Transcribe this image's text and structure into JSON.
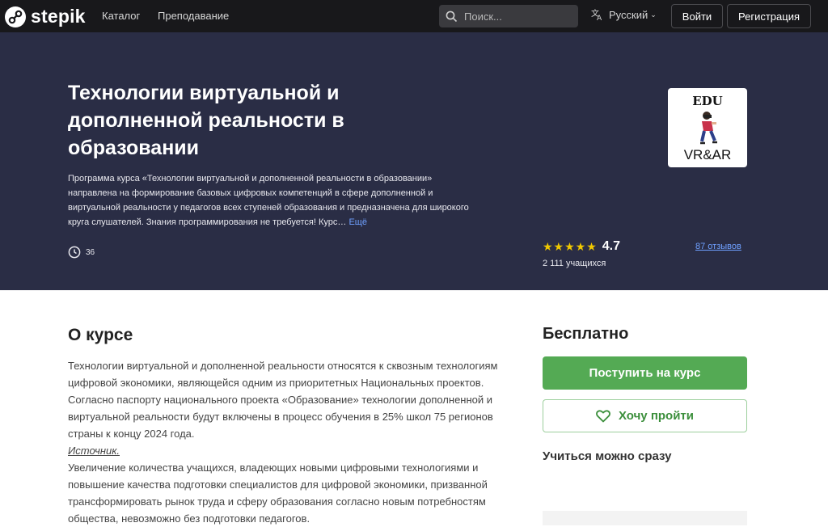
{
  "header": {
    "logo_text": "stepik",
    "nav": [
      "Каталог",
      "Преподавание"
    ],
    "search_placeholder": "Поиск...",
    "language": "Русский",
    "login_label": "Войти",
    "register_label": "Регистрация"
  },
  "course": {
    "title": "Технологии виртуальной и дополненной реальности в образовании",
    "description": "Программа курса «Технологии виртуальной и дополненной реальности в образовании» направлена на формирование базовых цифровых компетенций в сфере дополненной и виртуальной реальности у педагогов всех ступеней образования и предназначена для широкого круга слушателей. Знания программирования не требуется! Курс…",
    "more_label": "Ещё",
    "hours": "36",
    "cover": {
      "top_text": "EDU",
      "bottom_text": "VR&AR"
    },
    "rating": 4.7,
    "rating_text": "4.7",
    "stars": "★★★★★",
    "learners": "2 111 учащихся",
    "reviews": "87 отзывов"
  },
  "about": {
    "title": "О курсе",
    "paragraph1": "Технологии виртуальной и дополненной реальности относятся к сквозным технологиям цифровой экономики, являющейся одним из приоритетных Национальных проектов. Согласно паспорту национального проекта «Образование» технологии дополненной и виртуальной реальности будут включены в процесс обучения в 25% школ 75 регионов страны к концу 2024 года.",
    "source_label": "Источник.",
    "paragraph2": "Увеличение количества учащихся, владеющих новыми цифровыми технологиями и повышение качества подготовки специалистов для цифровой экономики, призванной трансформировать рынок труда и сферу образования согласно новым потребностям общества, невозможно без подготовки педагогов."
  },
  "sidebar": {
    "price": "Бесплатно",
    "enroll_label": "Поступить на курс",
    "wishlist_label": "Хочу пройти",
    "start_note": "Учиться можно сразу"
  },
  "colors": {
    "topbar": "#18181b",
    "hero": "#2a2d45",
    "accent_green": "#54aa54",
    "link_blue": "#6fa0ff",
    "star": "#f0c800"
  }
}
